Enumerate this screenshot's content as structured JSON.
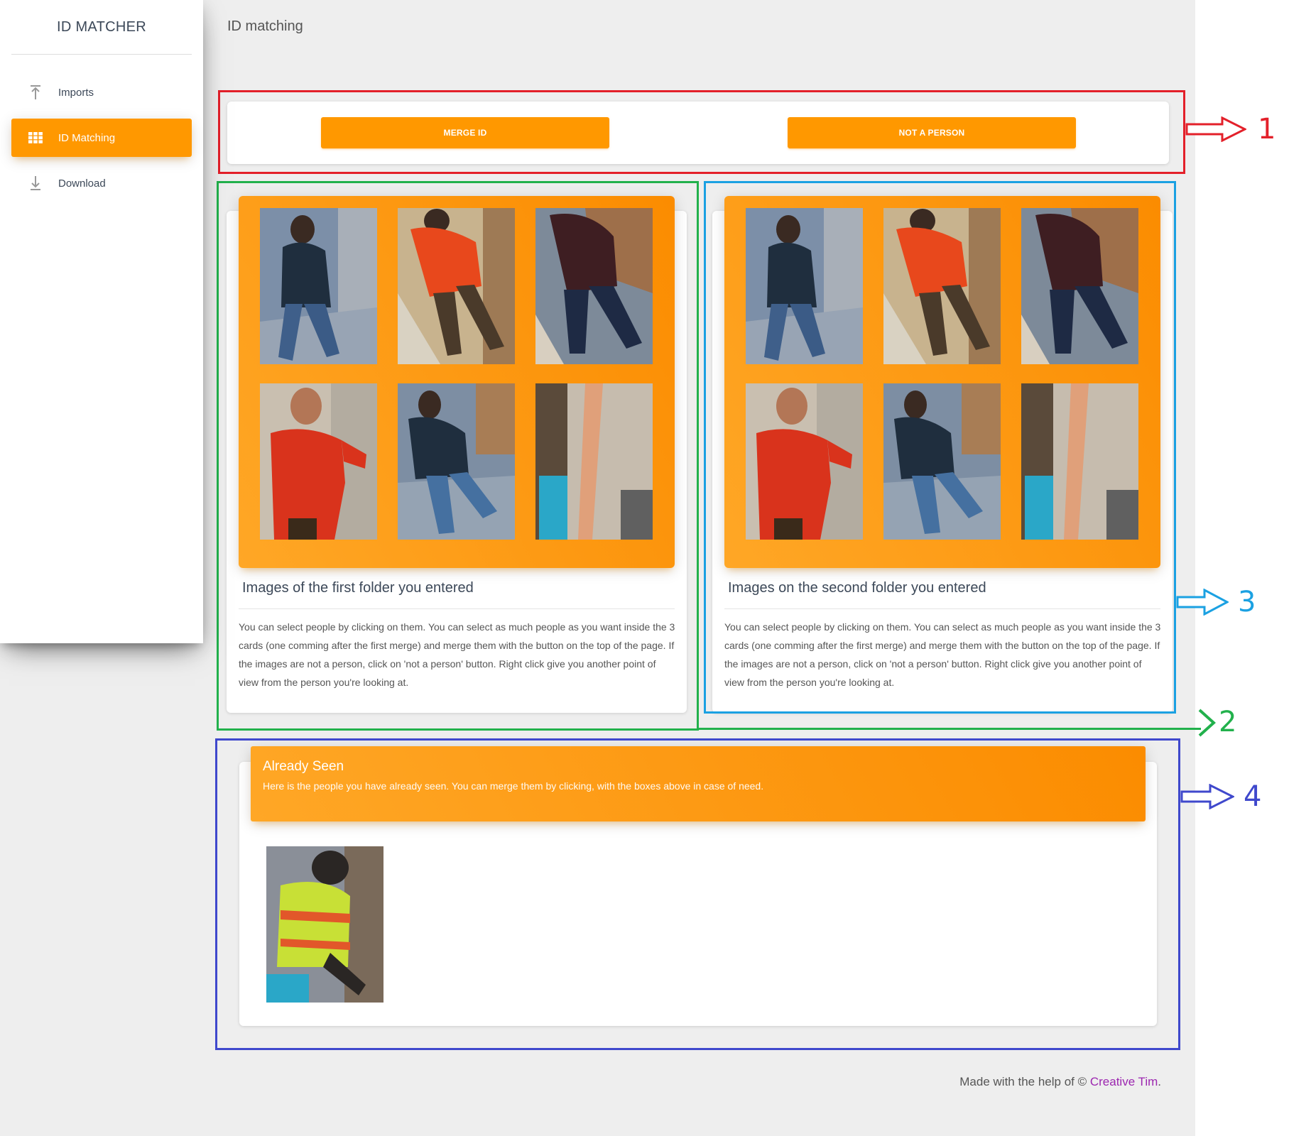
{
  "sidebar": {
    "logo": "ID MATCHER",
    "items": [
      {
        "label": "Imports",
        "icon": "upload-icon"
      },
      {
        "label": "ID Matching",
        "icon": "grid-icon"
      },
      {
        "label": "Download",
        "icon": "download-icon"
      }
    ]
  },
  "navbar": {
    "title": "ID matching"
  },
  "actions": {
    "merge_label": "MERGE ID",
    "not_person_label": "NOT A PERSON"
  },
  "folder1": {
    "title": "Images of the first folder you entered",
    "description": "You can select people by clicking on them. You can select as much people as you want inside the 3 cards (one comming after the first merge) and merge them with the button on the top of the page. If the images are not a person, click on 'not a person' button. Right click give you another point of view from the person you're looking at."
  },
  "folder2": {
    "title": "Images on the second folder you entered",
    "description": "You can select people by clicking on them. You can select as much people as you want inside the 3 cards (one comming after the first merge) and merge them with the button on the top of the page. If the images are not a person, click on 'not a person' button. Right click give you another point of view from the person you're looking at."
  },
  "already_seen": {
    "title": "Already Seen",
    "description": "Here is the people you have already seen. You can merge them by clicking, with the boxes above in case of need."
  },
  "footer": {
    "prefix": "Made with the help of © ",
    "link": "Creative Tim",
    "suffix": "."
  },
  "annotations": [
    {
      "label": "1",
      "color": "#e3202a"
    },
    {
      "label": "2",
      "color": "#22b14c"
    },
    {
      "label": "3",
      "color": "#1ba1e2"
    },
    {
      "label": "4",
      "color": "#3f48cc"
    }
  ],
  "colors": {
    "accent": "#ff9800",
    "link": "#9c27b0"
  }
}
